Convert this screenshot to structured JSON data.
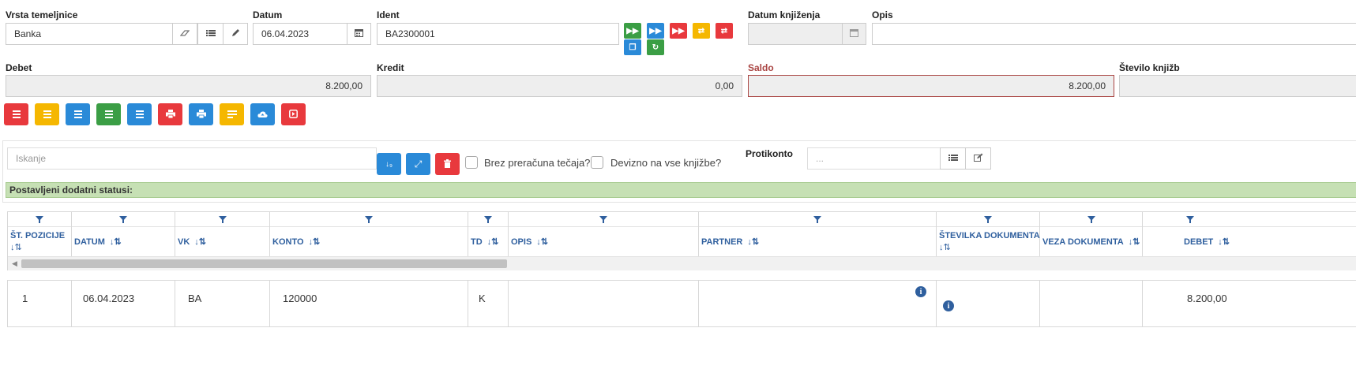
{
  "header": {
    "vrsta_label": "Vrsta temeljnice",
    "vrsta_value": "Banka",
    "datum_label": "Datum",
    "datum_value": "06.04.2023",
    "ident_label": "Ident",
    "ident_value": "BA2300001",
    "datum_knjizenja_label": "Datum knjiženja",
    "datum_knjizenja_value": "",
    "opis_label": "Opis",
    "opis_value": ""
  },
  "totals": {
    "debet_label": "Debet",
    "debet_value": "8.200,00",
    "kredit_label": "Kredit",
    "kredit_value": "0,00",
    "saldo_label": "Saldo",
    "saldo_value": "8.200,00",
    "stevilo_label": "Število knjižb",
    "stevilo_value": ""
  },
  "filters": {
    "search_placeholder": "Iskanje",
    "brez_preracuna_label": "Brez preračuna tečaja?",
    "devizno_label": "Devizno na vse knjižbe?",
    "protikonto_label": "Protikonto",
    "protikonto_placeholder": "...",
    "status_text": "Postavljeni dodatni statusi:"
  },
  "table": {
    "columns": [
      "ŠT. POZICIJE",
      "DATUM",
      "VK",
      "KONTO",
      "TD",
      "OPIS",
      "PARTNER",
      "ŠTEVILKA DOKUMENTA",
      "VEZA DOKUMENTA",
      "DEBET"
    ],
    "rows": [
      {
        "pozicija": "1",
        "datum": "06.04.2023",
        "vk": "BA",
        "konto": "120000",
        "td": "K",
        "opis": "",
        "partner": "",
        "stevilka": "",
        "veza": "",
        "debet": "8.200,00"
      }
    ]
  },
  "colors": {
    "green": "#3b9e45",
    "blue": "#2a8ad8",
    "red": "#e8393d",
    "orange": "#f5b700",
    "status_bg": "#c6e0b4",
    "header_text": "#2f5f9e"
  }
}
